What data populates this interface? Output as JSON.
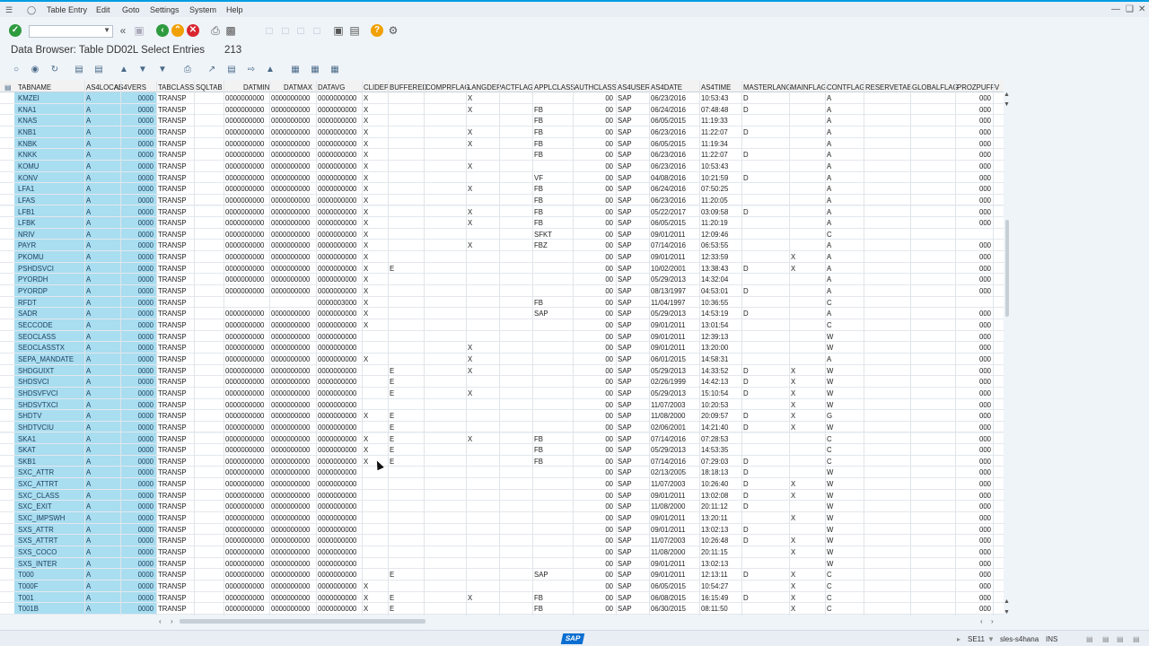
{
  "menu": {
    "items": [
      "Table Entry",
      "Edit",
      "Goto",
      "Settings",
      "System",
      "Help"
    ]
  },
  "title": "Data Browser: Table DD02L Select Entries",
  "entry_count": "213",
  "columns": [
    "TABNAME",
    "AS4LOCAL",
    "AS4VERS",
    "TABCLASS",
    "SQLTAB",
    "DATMIN",
    "DATMAX",
    "DATAVG",
    "CLIDEP",
    "BUFFERED",
    "COMPRFLAG",
    "LANGDEP",
    "ACTFLAG",
    "APPLCLASS",
    "AUTHCLASS",
    "AS4USER",
    "AS4DATE",
    "AS4TIME",
    "MASTERLANG",
    "MAINFLAG",
    "CONTFLAG",
    "RESERVETAB",
    "GLOBALFLAG",
    "PROZPUFF",
    "V"
  ],
  "rows": [
    [
      "KMZEI",
      "A",
      "0000",
      "TRANSP",
      "",
      "0000000000",
      "0000000000",
      "0000000000",
      "X",
      "",
      "",
      "X",
      "",
      "",
      "00",
      "SAP",
      "06/23/2016",
      "10:53:43",
      "D",
      "",
      "A",
      "",
      "",
      "000"
    ],
    [
      "KNA1",
      "A",
      "0000",
      "TRANSP",
      "",
      "0000000000",
      "0000000000",
      "0000000000",
      "X",
      "",
      "",
      "X",
      "",
      "FB",
      "00",
      "SAP",
      "06/24/2016",
      "07:48:48",
      "D",
      "",
      "A",
      "",
      "",
      "000"
    ],
    [
      "KNAS",
      "A",
      "0000",
      "TRANSP",
      "",
      "0000000000",
      "0000000000",
      "0000000000",
      "X",
      "",
      "",
      "",
      "",
      "FB",
      "00",
      "SAP",
      "06/05/2015",
      "11:19:33",
      "",
      "",
      "A",
      "",
      "",
      "000"
    ],
    [
      "KNB1",
      "A",
      "0000",
      "TRANSP",
      "",
      "0000000000",
      "0000000000",
      "0000000000",
      "X",
      "",
      "",
      "X",
      "",
      "FB",
      "00",
      "SAP",
      "06/23/2016",
      "11:22:07",
      "D",
      "",
      "A",
      "",
      "",
      "000"
    ],
    [
      "KNBK",
      "A",
      "0000",
      "TRANSP",
      "",
      "0000000000",
      "0000000000",
      "0000000000",
      "X",
      "",
      "",
      "X",
      "",
      "FB",
      "00",
      "SAP",
      "06/05/2015",
      "11:19:34",
      "",
      "",
      "A",
      "",
      "",
      "000"
    ],
    [
      "KNKK",
      "A",
      "0000",
      "TRANSP",
      "",
      "0000000000",
      "0000000000",
      "0000000000",
      "X",
      "",
      "",
      "",
      "",
      "FB",
      "00",
      "SAP",
      "06/23/2016",
      "11:22:07",
      "D",
      "",
      "A",
      "",
      "",
      "000"
    ],
    [
      "KOMU",
      "A",
      "0000",
      "TRANSP",
      "",
      "0000000000",
      "0000000000",
      "0000000000",
      "X",
      "",
      "",
      "X",
      "",
      "",
      "00",
      "SAP",
      "06/23/2016",
      "10:53:43",
      "",
      "",
      "A",
      "",
      "",
      "000"
    ],
    [
      "KONV",
      "A",
      "0000",
      "TRANSP",
      "",
      "0000000000",
      "0000000000",
      "0000000000",
      "X",
      "",
      "",
      "",
      "",
      "VF",
      "00",
      "SAP",
      "04/08/2016",
      "10:21:59",
      "D",
      "",
      "A",
      "",
      "",
      "000"
    ],
    [
      "LFA1",
      "A",
      "0000",
      "TRANSP",
      "",
      "0000000000",
      "0000000000",
      "0000000000",
      "X",
      "",
      "",
      "X",
      "",
      "FB",
      "00",
      "SAP",
      "06/24/2016",
      "07:50:25",
      "",
      "",
      "A",
      "",
      "",
      "000"
    ],
    [
      "LFAS",
      "A",
      "0000",
      "TRANSP",
      "",
      "0000000000",
      "0000000000",
      "0000000000",
      "X",
      "",
      "",
      "",
      "",
      "FB",
      "00",
      "SAP",
      "06/23/2016",
      "11:20:05",
      "",
      "",
      "A",
      "",
      "",
      "000"
    ],
    [
      "LFB1",
      "A",
      "0000",
      "TRANSP",
      "",
      "0000000000",
      "0000000000",
      "0000000000",
      "X",
      "",
      "",
      "X",
      "",
      "FB",
      "00",
      "SAP",
      "05/22/2017",
      "03:09:58",
      "D",
      "",
      "A",
      "",
      "",
      "000"
    ],
    [
      "LFBK",
      "A",
      "0000",
      "TRANSP",
      "",
      "0000000000",
      "0000000000",
      "0000000000",
      "X",
      "",
      "",
      "X",
      "",
      "FB",
      "00",
      "SAP",
      "06/05/2015",
      "11:20:19",
      "",
      "",
      "A",
      "",
      "",
      "000"
    ],
    [
      "NRIV",
      "A",
      "0000",
      "TRANSP",
      "",
      "0000000000",
      "0000000000",
      "0000000000",
      "X",
      "",
      "",
      "",
      "",
      "SFKT",
      "00",
      "SAP",
      "09/01/2011",
      "12:09:46",
      "",
      "",
      "C",
      "",
      "",
      ""
    ],
    [
      "PAYR",
      "A",
      "0000",
      "TRANSP",
      "",
      "0000000000",
      "0000000000",
      "0000000000",
      "X",
      "",
      "",
      "X",
      "",
      "FBZ",
      "00",
      "SAP",
      "07/14/2016",
      "06:53:55",
      "",
      "",
      "A",
      "",
      "",
      "000"
    ],
    [
      "PKOMU",
      "A",
      "0000",
      "TRANSP",
      "",
      "0000000000",
      "0000000000",
      "0000000000",
      "X",
      "",
      "",
      "",
      "",
      "",
      "00",
      "SAP",
      "09/01/2011",
      "12:33:59",
      "",
      "X",
      "A",
      "",
      "",
      "000"
    ],
    [
      "PSHDSVCI",
      "A",
      "0000",
      "TRANSP",
      "",
      "0000000000",
      "0000000000",
      "0000000000",
      "X",
      "E",
      "",
      "",
      "",
      "",
      "00",
      "SAP",
      "10/02/2001",
      "13:38:43",
      "D",
      "X",
      "A",
      "",
      "",
      "000"
    ],
    [
      "PYORDH",
      "A",
      "0000",
      "TRANSP",
      "",
      "0000000000",
      "0000000000",
      "0000000000",
      "X",
      "",
      "",
      "",
      "",
      "",
      "00",
      "SAP",
      "05/29/2013",
      "14:32:04",
      "",
      "",
      "A",
      "",
      "",
      "000"
    ],
    [
      "PYORDP",
      "A",
      "0000",
      "TRANSP",
      "",
      "0000000000",
      "0000000000",
      "0000000000",
      "X",
      "",
      "",
      "",
      "",
      "",
      "00",
      "SAP",
      "08/13/1997",
      "04:53:01",
      "D",
      "",
      "A",
      "",
      "",
      "000"
    ],
    [
      "RFDT",
      "A",
      "0000",
      "TRANSP",
      "",
      "",
      "",
      "0000003000",
      "X",
      "",
      "",
      "",
      "",
      "FB",
      "00",
      "SAP",
      "11/04/1997",
      "10:36:55",
      "",
      "",
      "C",
      "",
      "",
      ""
    ],
    [
      "SADR",
      "A",
      "0000",
      "TRANSP",
      "",
      "0000000000",
      "0000000000",
      "0000000000",
      "X",
      "",
      "",
      "",
      "",
      "SAP",
      "00",
      "SAP",
      "05/29/2013",
      "14:53:19",
      "D",
      "",
      "A",
      "",
      "",
      "000"
    ],
    [
      "SECCODE",
      "A",
      "0000",
      "TRANSP",
      "",
      "0000000000",
      "0000000000",
      "0000000000",
      "X",
      "",
      "",
      "",
      "",
      "",
      "00",
      "SAP",
      "09/01/2011",
      "13:01:54",
      "",
      "",
      "C",
      "",
      "",
      "000"
    ],
    [
      "SEOCLASS",
      "A",
      "0000",
      "TRANSP",
      "",
      "0000000000",
      "0000000000",
      "0000000000",
      "",
      "",
      "",
      "",
      "",
      "",
      "00",
      "SAP",
      "09/01/2011",
      "12:39:13",
      "",
      "",
      "W",
      "",
      "",
      "000"
    ],
    [
      "SEOCLASSTX",
      "A",
      "0000",
      "TRANSP",
      "",
      "0000000000",
      "0000000000",
      "0000000000",
      "",
      "",
      "",
      "X",
      "",
      "",
      "00",
      "SAP",
      "09/01/2011",
      "13:20:00",
      "",
      "",
      "W",
      "",
      "",
      "000"
    ],
    [
      "SEPA_MANDATE",
      "A",
      "0000",
      "TRANSP",
      "",
      "0000000000",
      "0000000000",
      "0000000000",
      "X",
      "",
      "",
      "X",
      "",
      "",
      "00",
      "SAP",
      "06/01/2015",
      "14:58:31",
      "",
      "",
      "A",
      "",
      "",
      "000"
    ],
    [
      "SHDGUIXT",
      "A",
      "0000",
      "TRANSP",
      "",
      "0000000000",
      "0000000000",
      "0000000000",
      "",
      "E",
      "",
      "X",
      "",
      "",
      "00",
      "SAP",
      "05/29/2013",
      "14:33:52",
      "D",
      "X",
      "W",
      "",
      "",
      "000"
    ],
    [
      "SHDSVCI",
      "A",
      "0000",
      "TRANSP",
      "",
      "0000000000",
      "0000000000",
      "0000000000",
      "",
      "E",
      "",
      "",
      "",
      "",
      "00",
      "SAP",
      "02/26/1999",
      "14:42:13",
      "D",
      "X",
      "W",
      "",
      "",
      "000"
    ],
    [
      "SHDSVFVCI",
      "A",
      "0000",
      "TRANSP",
      "",
      "0000000000",
      "0000000000",
      "0000000000",
      "",
      "E",
      "",
      "X",
      "",
      "",
      "00",
      "SAP",
      "05/29/2013",
      "15:10:54",
      "D",
      "X",
      "W",
      "",
      "",
      "000"
    ],
    [
      "SHDSVTXCI",
      "A",
      "0000",
      "TRANSP",
      "",
      "0000000000",
      "0000000000",
      "0000000000",
      "",
      "",
      "",
      "",
      "",
      "",
      "00",
      "SAP",
      "11/07/2003",
      "10:20:53",
      "",
      "X",
      "W",
      "",
      "",
      "000"
    ],
    [
      "SHDTV",
      "A",
      "0000",
      "TRANSP",
      "",
      "0000000000",
      "0000000000",
      "0000000000",
      "X",
      "E",
      "",
      "",
      "",
      "",
      "00",
      "SAP",
      "11/08/2000",
      "20:09:57",
      "D",
      "X",
      "G",
      "",
      "",
      "000"
    ],
    [
      "SHDTVCIU",
      "A",
      "0000",
      "TRANSP",
      "",
      "0000000000",
      "0000000000",
      "0000000000",
      "",
      "E",
      "",
      "",
      "",
      "",
      "00",
      "SAP",
      "02/06/2001",
      "14:21:40",
      "D",
      "X",
      "W",
      "",
      "",
      "000"
    ],
    [
      "SKA1",
      "A",
      "0000",
      "TRANSP",
      "",
      "0000000000",
      "0000000000",
      "0000000000",
      "X",
      "E",
      "",
      "X",
      "",
      "FB",
      "00",
      "SAP",
      "07/14/2016",
      "07:28:53",
      "",
      "",
      "C",
      "",
      "",
      "000"
    ],
    [
      "SKAT",
      "A",
      "0000",
      "TRANSP",
      "",
      "0000000000",
      "0000000000",
      "0000000000",
      "X",
      "E",
      "",
      "",
      "",
      "FB",
      "00",
      "SAP",
      "05/29/2013",
      "14:53:35",
      "",
      "",
      "C",
      "",
      "",
      "000"
    ],
    [
      "SKB1",
      "A",
      "0000",
      "TRANSP",
      "",
      "0000000000",
      "0000000000",
      "0000000000",
      "X",
      "E",
      "",
      "",
      "",
      "FB",
      "00",
      "SAP",
      "07/14/2016",
      "07:29:03",
      "D",
      "",
      "C",
      "",
      "",
      "000"
    ],
    [
      "SXC_ATTR",
      "A",
      "0000",
      "TRANSP",
      "",
      "0000000000",
      "0000000000",
      "0000000000",
      "",
      "",
      "",
      "",
      "",
      "",
      "00",
      "SAP",
      "02/13/2005",
      "18:18:13",
      "D",
      "",
      "W",
      "",
      "",
      "000"
    ],
    [
      "SXC_ATTRT",
      "A",
      "0000",
      "TRANSP",
      "",
      "0000000000",
      "0000000000",
      "0000000000",
      "",
      "",
      "",
      "",
      "",
      "",
      "00",
      "SAP",
      "11/07/2003",
      "10:26:40",
      "D",
      "X",
      "W",
      "",
      "",
      "000"
    ],
    [
      "SXC_CLASS",
      "A",
      "0000",
      "TRANSP",
      "",
      "0000000000",
      "0000000000",
      "0000000000",
      "",
      "",
      "",
      "",
      "",
      "",
      "00",
      "SAP",
      "09/01/2011",
      "13:02:08",
      "D",
      "X",
      "W",
      "",
      "",
      "000"
    ],
    [
      "SXC_EXIT",
      "A",
      "0000",
      "TRANSP",
      "",
      "0000000000",
      "0000000000",
      "0000000000",
      "",
      "",
      "",
      "",
      "",
      "",
      "00",
      "SAP",
      "11/08/2000",
      "20:11:12",
      "D",
      "",
      "W",
      "",
      "",
      "000"
    ],
    [
      "SXC_IMPSWH",
      "A",
      "0000",
      "TRANSP",
      "",
      "0000000000",
      "0000000000",
      "0000000000",
      "",
      "",
      "",
      "",
      "",
      "",
      "00",
      "SAP",
      "09/01/2011",
      "13:20:11",
      "",
      "X",
      "W",
      "",
      "",
      "000"
    ],
    [
      "SXS_ATTR",
      "A",
      "0000",
      "TRANSP",
      "",
      "0000000000",
      "0000000000",
      "0000000000",
      "",
      "",
      "",
      "",
      "",
      "",
      "00",
      "SAP",
      "09/01/2011",
      "13:02:13",
      "D",
      "",
      "W",
      "",
      "",
      "000"
    ],
    [
      "SXS_ATTRT",
      "A",
      "0000",
      "TRANSP",
      "",
      "0000000000",
      "0000000000",
      "0000000000",
      "",
      "",
      "",
      "",
      "",
      "",
      "00",
      "SAP",
      "11/07/2003",
      "10:26:48",
      "D",
      "X",
      "W",
      "",
      "",
      "000"
    ],
    [
      "SXS_COCO",
      "A",
      "0000",
      "TRANSP",
      "",
      "0000000000",
      "0000000000",
      "0000000000",
      "",
      "",
      "",
      "",
      "",
      "",
      "00",
      "SAP",
      "11/08/2000",
      "20:11:15",
      "",
      "X",
      "W",
      "",
      "",
      "000"
    ],
    [
      "SXS_INTER",
      "A",
      "0000",
      "TRANSP",
      "",
      "0000000000",
      "0000000000",
      "0000000000",
      "",
      "",
      "",
      "",
      "",
      "",
      "00",
      "SAP",
      "09/01/2011",
      "13:02:13",
      "",
      "",
      "W",
      "",
      "",
      "000"
    ],
    [
      "T000",
      "A",
      "0000",
      "TRANSP",
      "",
      "0000000000",
      "0000000000",
      "0000000000",
      "",
      "E",
      "",
      "",
      "",
      "SAP",
      "00",
      "SAP",
      "09/01/2011",
      "12:13:11",
      "D",
      "X",
      "C",
      "",
      "",
      "000"
    ],
    [
      "T000F",
      "A",
      "0000",
      "TRANSP",
      "",
      "0000000000",
      "0000000000",
      "0000000000",
      "X",
      "",
      "",
      "",
      "",
      "",
      "00",
      "SAP",
      "06/05/2015",
      "10:54:27",
      "",
      "X",
      "C",
      "",
      "",
      "000"
    ],
    [
      "T001",
      "A",
      "0000",
      "TRANSP",
      "",
      "0000000000",
      "0000000000",
      "0000000000",
      "X",
      "E",
      "",
      "X",
      "",
      "FB",
      "00",
      "SAP",
      "06/08/2015",
      "16:15:49",
      "D",
      "X",
      "C",
      "",
      "",
      "000"
    ],
    [
      "T001B",
      "A",
      "0000",
      "TRANSP",
      "",
      "0000000000",
      "0000000000",
      "0000000000",
      "X",
      "E",
      "",
      "",
      "",
      "FB",
      "00",
      "SAP",
      "06/30/2015",
      "08:11:50",
      "",
      "X",
      "C",
      "",
      "",
      "000"
    ]
  ],
  "status": {
    "system": "SE11",
    "server": "sles-s4hana",
    "mode": "INS",
    "logo": "SAP"
  },
  "colors": {
    "accent": "#009de0",
    "key_column": "#a9ddf0",
    "status_green": "#2e9b3e"
  }
}
